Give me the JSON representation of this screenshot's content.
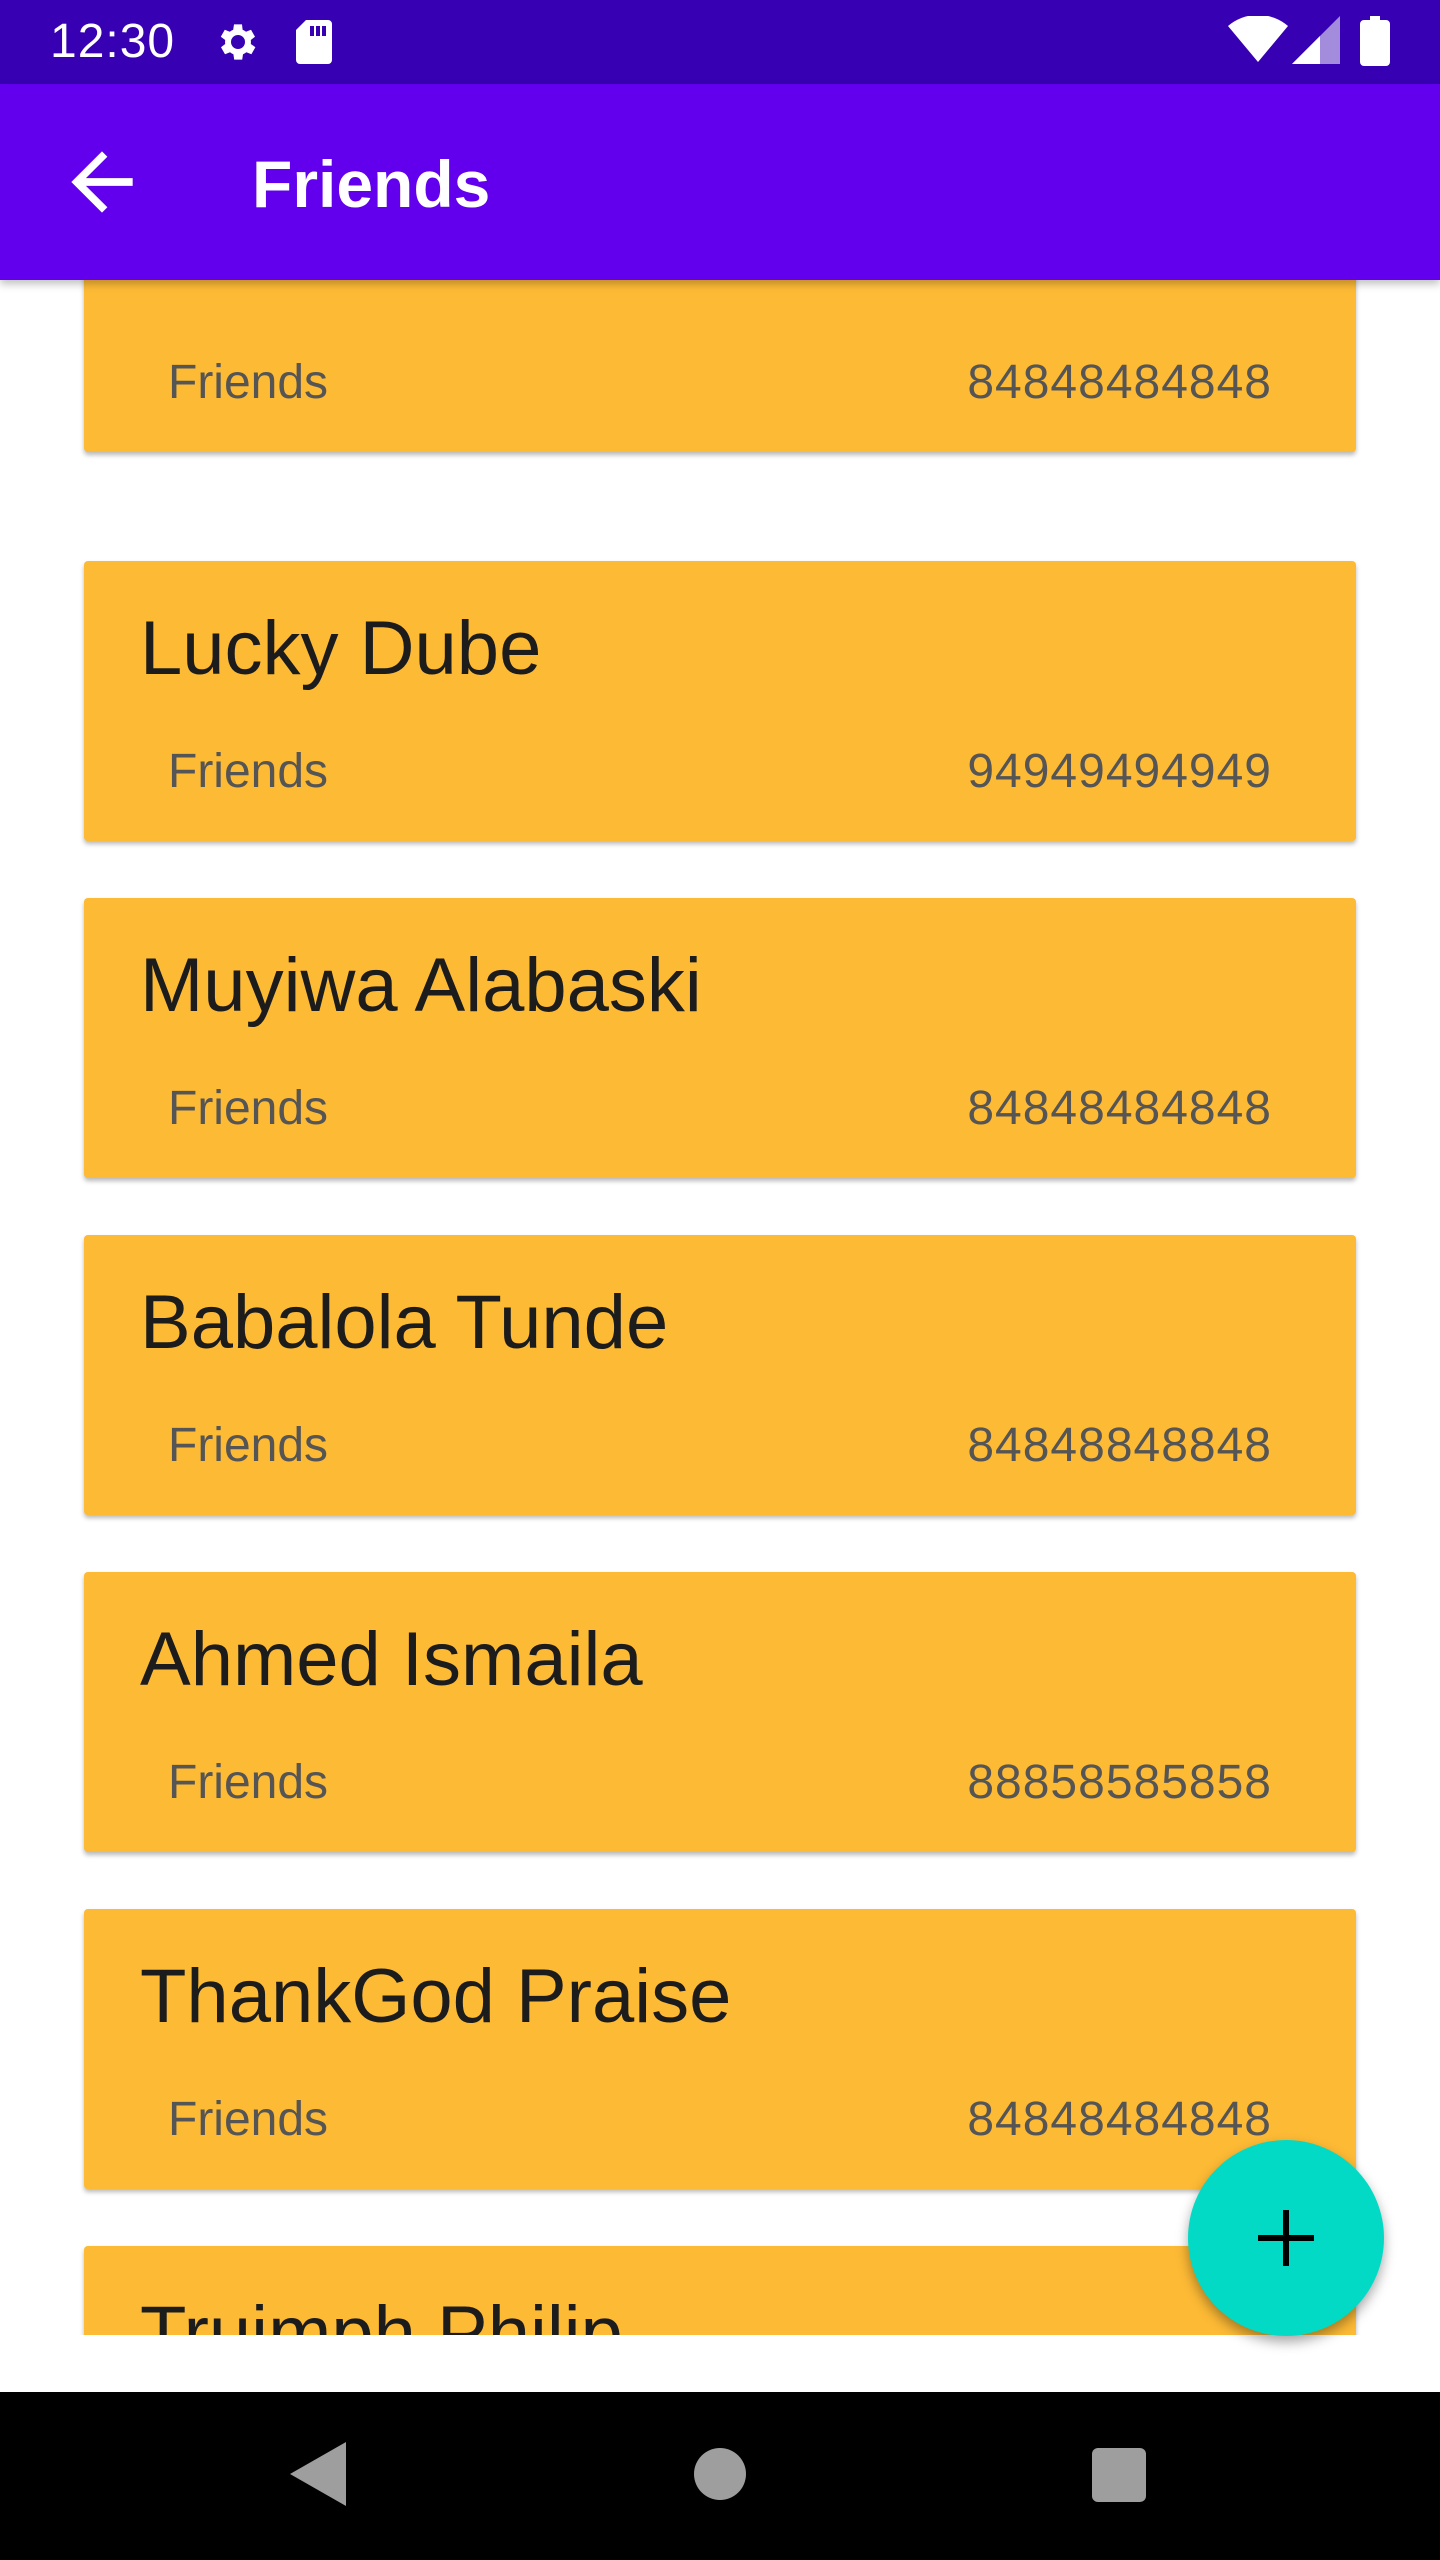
{
  "status_bar": {
    "time": "12:30",
    "icons": [
      "gear-icon",
      "sd-card-icon",
      "wifi-icon",
      "signal-icon",
      "battery-icon"
    ]
  },
  "app_bar": {
    "title": "Friends",
    "back_icon": "arrow-back-icon"
  },
  "contacts": [
    {
      "name": "",
      "group": "Friends",
      "phone": "84848484848"
    },
    {
      "name": "Lucky Dube",
      "group": "Friends",
      "phone": "94949494949"
    },
    {
      "name": "Muyiwa Alabaski",
      "group": "Friends",
      "phone": "84848484848"
    },
    {
      "name": "Babalola Tunde",
      "group": "Friends",
      "phone": "84848848848"
    },
    {
      "name": "Ahmed Ismaila",
      "group": "Friends",
      "phone": "88858585858"
    },
    {
      "name": "ThankGod Praise",
      "group": "Friends",
      "phone": "84848484848"
    },
    {
      "name": "Truimph Philip",
      "group": "",
      "phone": ""
    }
  ],
  "fab": {
    "icon": "plus-icon"
  },
  "nav_bar": {
    "icons": [
      "back-triangle-icon",
      "home-circle-icon",
      "recents-square-icon"
    ]
  },
  "colors": {
    "status_bar": "#3700B3",
    "app_bar": "#6200EE",
    "card": "#FDBA35",
    "fab": "#03DAC5"
  }
}
